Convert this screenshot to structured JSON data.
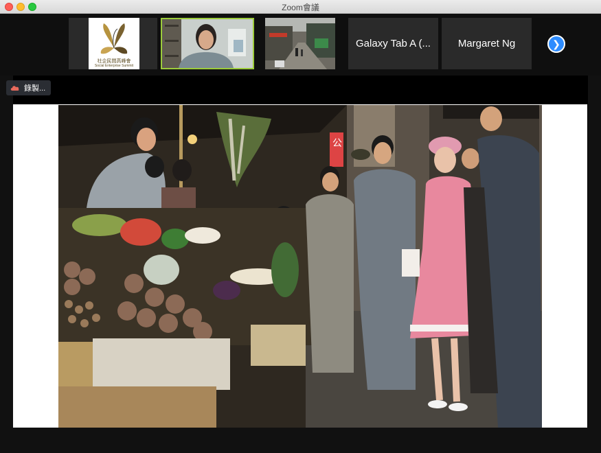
{
  "window": {
    "title": "Zoom會議"
  },
  "participants": [
    {
      "kind": "logo",
      "name": "",
      "logo_line1": "社企民間高峰會",
      "logo_line2": "Social Enterprise Summit"
    },
    {
      "kind": "video",
      "name": ""
    },
    {
      "kind": "video",
      "name": ""
    },
    {
      "kind": "name",
      "name": "Galaxy Tab A (..."
    },
    {
      "kind": "name",
      "name": "Margaret Ng"
    }
  ],
  "recording": {
    "label": "錄製..."
  },
  "photo": {
    "sign_text": "公"
  }
}
